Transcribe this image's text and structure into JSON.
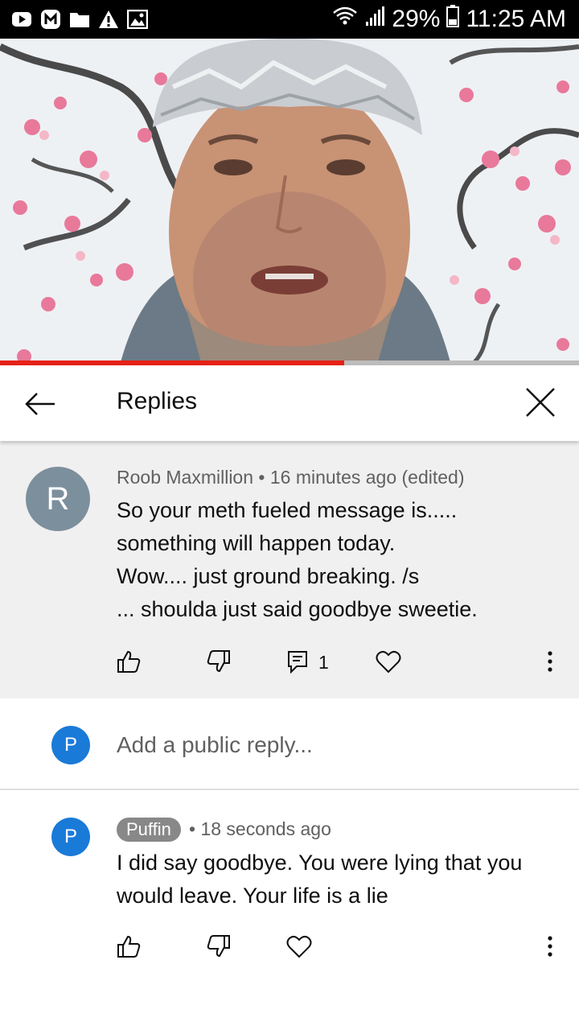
{
  "status_bar": {
    "battery": "29%",
    "time": "11:25 AM",
    "icons": [
      "youtube-icon",
      "m-app-icon",
      "folder-icon",
      "warning-icon",
      "gallery-icon",
      "wifi-icon",
      "signal-icon",
      "battery-icon"
    ]
  },
  "video": {
    "progress_fraction": 0.594,
    "progress_color": "#e62117"
  },
  "header": {
    "title": "Replies",
    "back_icon": "back-arrow-icon",
    "close_icon": "close-icon"
  },
  "comment": {
    "avatar_letter": "R",
    "author": "Roob Maxmillion",
    "time": "16 minutes ago (edited)",
    "lines": [
      "So your meth fueled message is.....",
      "something will happen today.",
      "Wow.... just ground breaking.  /s",
      "... shoulda just said goodbye sweetie."
    ],
    "reply_count": "1"
  },
  "add_reply": {
    "avatar_letter": "P",
    "placeholder": "Add a public reply..."
  },
  "reply": {
    "avatar_letter": "P",
    "author": "Puffin",
    "time": "18 seconds ago",
    "lines": [
      "I did say goodbye. You were lying that you",
      "would leave. Your life is a lie"
    ]
  },
  "colors": {
    "accent": "#1a7ad8",
    "comment_bg": "#f0f0f0",
    "avatar_r": "#7c8f9c"
  }
}
